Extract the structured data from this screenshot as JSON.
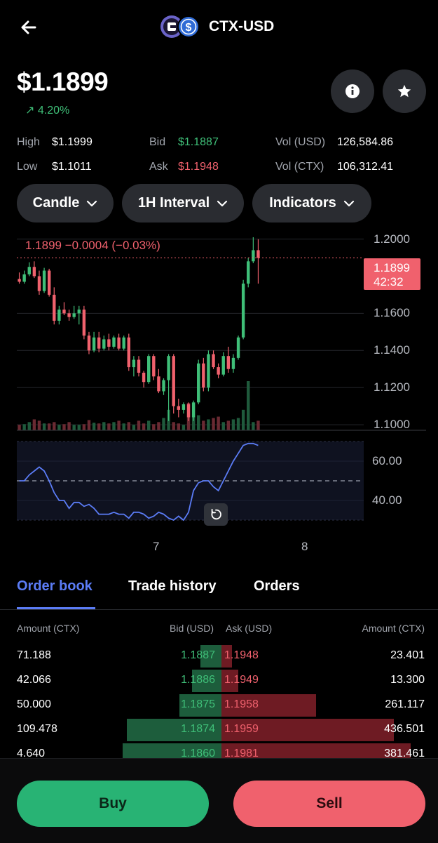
{
  "header": {
    "title": "CTX-USD",
    "back_icon": "arrow-left-icon",
    "logo_icons": [
      "ctx-coin-icon",
      "usd-coin-icon"
    ]
  },
  "price": {
    "value": "$1.1899",
    "change": "4.20%",
    "change_icon": "arrow-up-right-icon"
  },
  "actions": {
    "info_icon": "info-icon",
    "favorite_icon": "star-icon"
  },
  "stats": {
    "high_label": "High",
    "high_value": "$1.1999",
    "low_label": "Low",
    "low_value": "$1.1011",
    "bid_label": "Bid",
    "bid_value": "$1.1887",
    "ask_label": "Ask",
    "ask_value": "$1.1948",
    "vol_usd_label": "Vol (USD)",
    "vol_usd_value": "126,584.86",
    "vol_ctx_label": "Vol (CTX)",
    "vol_ctx_value": "106,312.41"
  },
  "controls": {
    "chart_type": "Candle",
    "interval": "1H Interval",
    "indicators": "Indicators"
  },
  "chart_data": [
    {
      "type": "candlestick",
      "header_text": "1.1899  −0.0004 (−0.03%)",
      "last_price_tag": "1.1899",
      "countdown": "42:32",
      "y_ticks": [
        "1.2000",
        "1.1600",
        "1.1400",
        "1.1200",
        "1.1000"
      ],
      "ylim": [
        1.097,
        1.204
      ],
      "candles": [
        [
          1.1785,
          1.182,
          1.176,
          1.177
        ],
        [
          1.177,
          1.183,
          1.176,
          1.181
        ],
        [
          1.181,
          1.1875,
          1.18,
          1.185
        ],
        [
          1.185,
          1.188,
          1.179,
          1.18
        ],
        [
          1.18,
          1.183,
          1.17,
          1.172
        ],
        [
          1.172,
          1.1845,
          1.171,
          1.183
        ],
        [
          1.183,
          1.184,
          1.169,
          1.17
        ],
        [
          1.17,
          1.174,
          1.154,
          1.156
        ],
        [
          1.156,
          1.164,
          1.154,
          1.162
        ],
        [
          1.162,
          1.166,
          1.159,
          1.16
        ],
        [
          1.16,
          1.162,
          1.156,
          1.158
        ],
        [
          1.158,
          1.164,
          1.157,
          1.16
        ],
        [
          1.16,
          1.164,
          1.154,
          1.162
        ],
        [
          1.162,
          1.164,
          1.146,
          1.148
        ],
        [
          1.148,
          1.15,
          1.138,
          1.14
        ],
        [
          1.14,
          1.15,
          1.139,
          1.147
        ],
        [
          1.147,
          1.15,
          1.139,
          1.141
        ],
        [
          1.141,
          1.148,
          1.14,
          1.146
        ],
        [
          1.146,
          1.149,
          1.14,
          1.142
        ],
        [
          1.142,
          1.148,
          1.141,
          1.147
        ],
        [
          1.147,
          1.149,
          1.14,
          1.141
        ],
        [
          1.141,
          1.148,
          1.14,
          1.147
        ],
        [
          1.147,
          1.149,
          1.129,
          1.131
        ],
        [
          1.131,
          1.137,
          1.126,
          1.135
        ],
        [
          1.135,
          1.137,
          1.126,
          1.128
        ],
        [
          1.128,
          1.129,
          1.12,
          1.123
        ],
        [
          1.123,
          1.138,
          1.122,
          1.137
        ],
        [
          1.137,
          1.138,
          1.124,
          1.126
        ],
        [
          1.126,
          1.13,
          1.117,
          1.118
        ],
        [
          1.118,
          1.125,
          1.116,
          1.124
        ],
        [
          1.124,
          1.138,
          1.102,
          1.137
        ],
        [
          1.137,
          1.138,
          1.106,
          1.11
        ],
        [
          1.11,
          1.114,
          1.104,
          1.108
        ],
        [
          1.108,
          1.112,
          1.106,
          1.111
        ],
        [
          1.111,
          1.112,
          1.102,
          1.104
        ],
        [
          1.104,
          1.113,
          1.102,
          1.112
        ],
        [
          1.112,
          1.135,
          1.111,
          1.133
        ],
        [
          1.133,
          1.136,
          1.118,
          1.12
        ],
        [
          1.12,
          1.14,
          1.118,
          1.138
        ],
        [
          1.138,
          1.14,
          1.13,
          1.131
        ],
        [
          1.131,
          1.133,
          1.125,
          1.127
        ],
        [
          1.127,
          1.139,
          1.126,
          1.137
        ],
        [
          1.137,
          1.142,
          1.128,
          1.13
        ],
        [
          1.13,
          1.138,
          1.128,
          1.136
        ],
        [
          1.136,
          1.148,
          1.135,
          1.147
        ],
        [
          1.147,
          1.178,
          1.146,
          1.176
        ],
        [
          1.176,
          1.19,
          1.174,
          1.188
        ],
        [
          1.188,
          1.201,
          1.187,
          1.194
        ],
        [
          1.194,
          1.1999,
          1.176,
          1.1899
        ]
      ],
      "volumes": [
        8,
        9,
        12,
        16,
        14,
        10,
        10,
        12,
        8,
        9,
        12,
        8,
        8,
        9,
        15,
        11,
        10,
        12,
        10,
        12,
        14,
        10,
        12,
        8,
        14,
        10,
        14,
        9,
        12,
        18,
        30,
        12,
        10,
        8,
        40,
        20,
        22,
        14,
        16,
        18,
        20,
        12,
        14,
        16,
        18,
        30,
        72,
        12,
        14
      ]
    },
    {
      "type": "line",
      "name": "RSI",
      "y_ticks": [
        "60.00",
        "40.00"
      ],
      "ylim": [
        30,
        70
      ],
      "midline": 50,
      "values": [
        50,
        50,
        53,
        55,
        57,
        55,
        50,
        44,
        40,
        40,
        36,
        39,
        39,
        37,
        38,
        36,
        33,
        33,
        33,
        34,
        33,
        33,
        31,
        34,
        34,
        33,
        31,
        32,
        34,
        33,
        31,
        30,
        32,
        30,
        34,
        45,
        49,
        50,
        50,
        47,
        45,
        50,
        55,
        60,
        64,
        68,
        69,
        69,
        68
      ],
      "x_ticks": [
        "7",
        "8"
      ],
      "reset_icon": "reset-zoom-icon"
    }
  ],
  "tabs": {
    "order_book": "Order book",
    "trade_history": "Trade history",
    "orders": "Orders"
  },
  "order_book": {
    "col_amount_left": "Amount (CTX)",
    "col_bid": "Bid (USD)",
    "col_ask": "Ask (USD)",
    "col_amount_right": "Amount (CTX)",
    "rows": [
      {
        "amount_left": "71.188",
        "bid": "1.1887",
        "ask": "1.1948",
        "amount_right": "23.401",
        "bid_depth": 0.1,
        "ask_depth": 0.05
      },
      {
        "amount_left": "42.066",
        "bid": "1.1886",
        "ask": "1.1949",
        "amount_right": "13.300",
        "bid_depth": 0.14,
        "ask_depth": 0.08
      },
      {
        "amount_left": "50.000",
        "bid": "1.1875",
        "ask": "1.1958",
        "amount_right": "261.117",
        "bid_depth": 0.2,
        "ask_depth": 0.45
      },
      {
        "amount_left": "109.478",
        "bid": "1.1874",
        "ask": "1.1959",
        "amount_right": "436.501",
        "bid_depth": 0.45,
        "ask_depth": 0.82
      },
      {
        "amount_left": "4.640",
        "bid": "1.1860",
        "ask": "1.1981",
        "amount_right": "381.461",
        "bid_depth": 0.47,
        "ask_depth": 0.9
      }
    ]
  },
  "footer": {
    "buy": "Buy",
    "sell": "Sell"
  },
  "colors": {
    "up": "#3fbf78",
    "down": "#f0616d",
    "accent": "#5b7cf6",
    "buy": "#28b374",
    "sell": "#f0616d"
  }
}
